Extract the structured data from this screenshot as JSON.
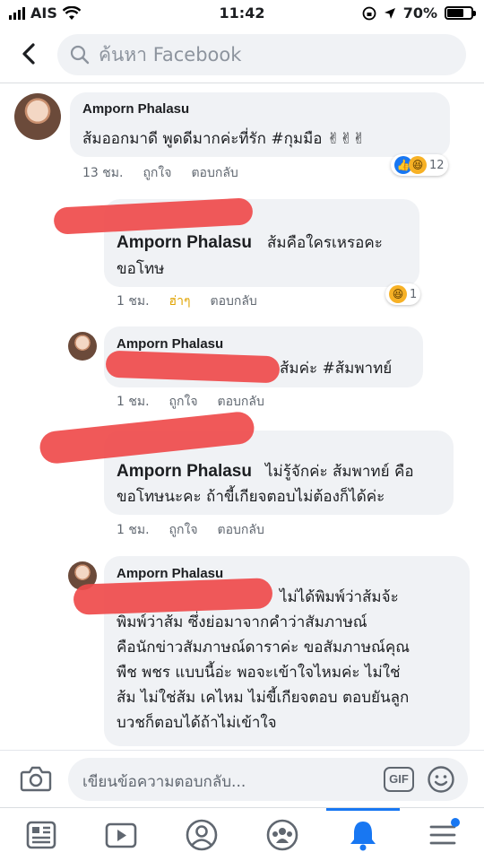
{
  "status": {
    "carrier": "AIS",
    "time": "11:42",
    "battery": "70%",
    "battery_level": 0.7
  },
  "header": {
    "search_placeholder": "ค้นหา Facebook",
    "back_icon": "chevron-left-icon",
    "search_icon": "search-icon"
  },
  "comments": [
    {
      "author": "Amporn Phalasu",
      "lines": [
        "ส้มออกมาดี พูดดีมากค่ะที่รัก #กุมมือ ✌✌✌"
      ],
      "time": "13 ชม.",
      "like": "ถูกใจ",
      "reply": "ตอบกลับ",
      "reaction_count": "12"
    },
    {
      "author": "Amporn Phalasu",
      "lines": [
        "ส้มคือใครเหรอคะ",
        "ขอโทษ"
      ],
      "time": "1 ชม.",
      "like": "ฮ่าๆ",
      "reply": "ตอบกลับ",
      "reaction_count": "1"
    },
    {
      "author": "Amporn Phalasu",
      "lines": [
        "ส้มค่ะ #ส้มพาทย์"
      ],
      "time": "1 ชม.",
      "like": "ถูกใจ",
      "reply": "ตอบกลับ"
    },
    {
      "author": "Amporn Phalasu",
      "lines": [
        "ไม่รู้จักค่ะ ส้มพาทย์ คือ",
        "ขอโทษนะคะ ถ้าขี้เกียจตอบไม่ต้องก็ได้ค่ะ"
      ],
      "time": "1 ชม.",
      "like": "ถูกใจ",
      "reply": "ตอบกลับ"
    },
    {
      "author": "Amporn Phalasu",
      "lines": [
        "ไม่ได้พิมพ์ว่าส้มจ้ะ",
        "พิมพ์ว่าส้ม ซึ่งย่อมาจากคำว่าสัมภาษณ์",
        "คือนักข่าวสัมภาษณ์ดาราค่ะ ขอสัมภาษณ์คุณ",
        "พืช พชร แบบนี้อ่ะ พอจะเข้าใจไหมค่ะ ไม่ใช่",
        "ส้ม ไม่ใช่ส้ม เคไหม ไม่ขี้เกียจตอบ ตอบยันลูก",
        "บวชก็ตอบได้ถ้าไม่เข้าใจ"
      ]
    }
  ],
  "composer": {
    "placeholder": "เขียนข้อความตอบกลับ...",
    "gif_label": "GIF"
  },
  "tabs": [
    "news-feed-icon",
    "watch-icon",
    "profile-icon",
    "groups-icon",
    "notifications-icon",
    "menu-icon"
  ],
  "colors": {
    "accent": "#1877f2",
    "haha": "#e0a300",
    "redaction": "#ef4b4b"
  }
}
